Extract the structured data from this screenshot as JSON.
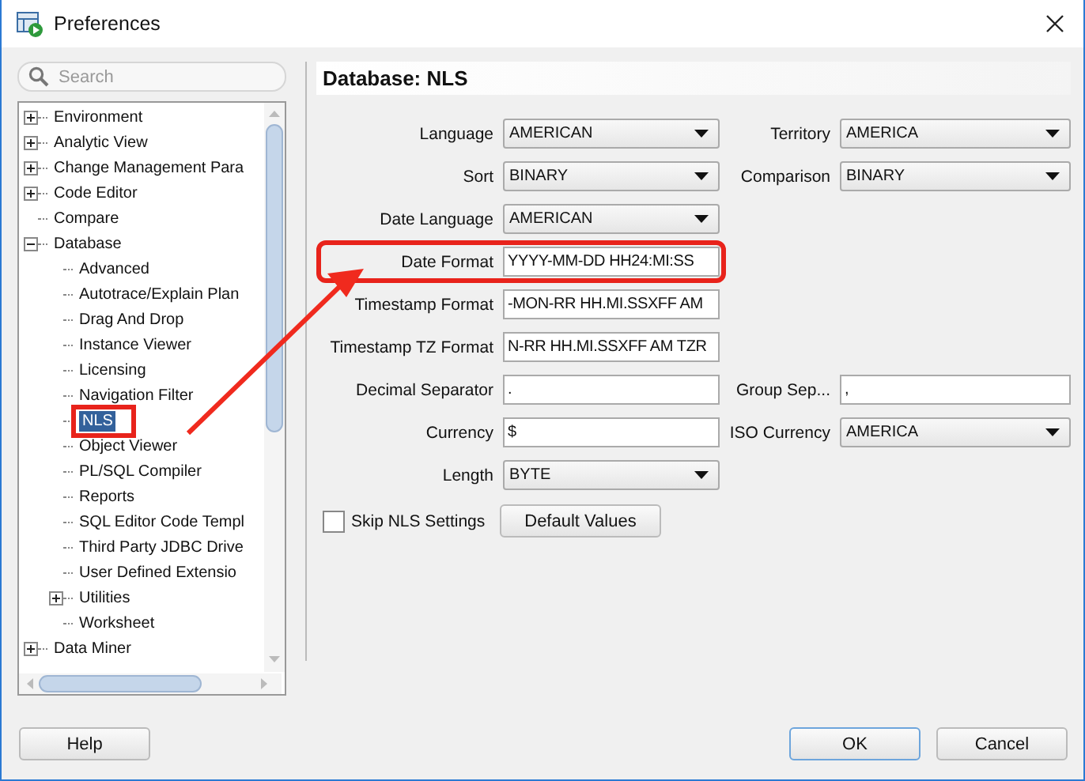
{
  "window": {
    "title": "Preferences"
  },
  "search": {
    "placeholder": "Search"
  },
  "tree": [
    {
      "label": "Environment",
      "expanded": false,
      "selected": false
    },
    {
      "label": "Analytic View",
      "expanded": false,
      "selected": false
    },
    {
      "label": "Change Management Para",
      "expanded": false,
      "selected": false
    },
    {
      "label": "Code Editor",
      "expanded": false,
      "selected": false
    },
    {
      "label": "Compare",
      "selected": false
    },
    {
      "label": "Database",
      "expanded": true,
      "selected": false,
      "children": [
        {
          "label": "Advanced",
          "selected": false
        },
        {
          "label": "Autotrace/Explain Plan",
          "selected": false
        },
        {
          "label": "Drag And Drop",
          "selected": false
        },
        {
          "label": "Instance Viewer",
          "selected": false
        },
        {
          "label": "Licensing",
          "selected": false
        },
        {
          "label": "Navigation Filter",
          "selected": false
        },
        {
          "label": "NLS",
          "selected": true,
          "highlighted": true
        },
        {
          "label": "Object Viewer",
          "selected": false
        },
        {
          "label": "PL/SQL Compiler",
          "selected": false
        },
        {
          "label": "Reports",
          "selected": false
        },
        {
          "label": "SQL Editor Code Templ",
          "selected": false
        },
        {
          "label": "Third Party JDBC Drive",
          "selected": false
        },
        {
          "label": "User Defined Extensio",
          "selected": false
        },
        {
          "label": "Utilities",
          "expanded": false,
          "selected": false
        },
        {
          "label": "Worksheet",
          "selected": false
        }
      ]
    },
    {
      "label": "Data Miner",
      "expanded": false,
      "selected": false
    }
  ],
  "panel": {
    "title": "Database: NLS"
  },
  "rows": [
    {
      "label": "Language",
      "field": {
        "kind": "select",
        "value": "AMERICAN"
      },
      "right": {
        "label": "Territory",
        "field": {
          "kind": "select",
          "value": "AMERICA"
        }
      }
    },
    {
      "label": "Sort",
      "field": {
        "kind": "select",
        "value": "BINARY"
      },
      "right": {
        "label": "Comparison",
        "field": {
          "kind": "select",
          "value": "BINARY"
        }
      }
    },
    {
      "label": "Date Language",
      "field": {
        "kind": "select",
        "value": "AMERICAN"
      }
    },
    {
      "label": "Date Format",
      "field": {
        "kind": "text",
        "value": "YYYY-MM-DD HH24:MI:SS"
      },
      "highlighted": true
    },
    {
      "label": "Timestamp Format",
      "field": {
        "kind": "text",
        "value": "-MON-RR HH.MI.SSXFF AM"
      }
    },
    {
      "label": "Timestamp TZ Format",
      "field": {
        "kind": "text",
        "value": "N-RR HH.MI.SSXFF AM TZR"
      }
    },
    {
      "label": "Decimal Separator",
      "field": {
        "kind": "text",
        "value": "."
      },
      "right": {
        "label": "Group Sep...",
        "field": {
          "kind": "text",
          "value": ","
        }
      }
    },
    {
      "label": "Currency",
      "field": {
        "kind": "text",
        "value": "$"
      },
      "right": {
        "label": "ISO Currency",
        "field": {
          "kind": "select",
          "value": "AMERICA"
        }
      }
    },
    {
      "label": "Length",
      "field": {
        "kind": "select",
        "value": "BYTE"
      }
    }
  ],
  "skip": {
    "label": "Skip NLS Settings",
    "checked": false
  },
  "default_button": "Default Values",
  "footer": {
    "left": [
      {
        "label": "Help",
        "default": false
      }
    ],
    "right": [
      {
        "label": "OK",
        "default": true
      },
      {
        "label": "Cancel",
        "default": false
      }
    ]
  }
}
